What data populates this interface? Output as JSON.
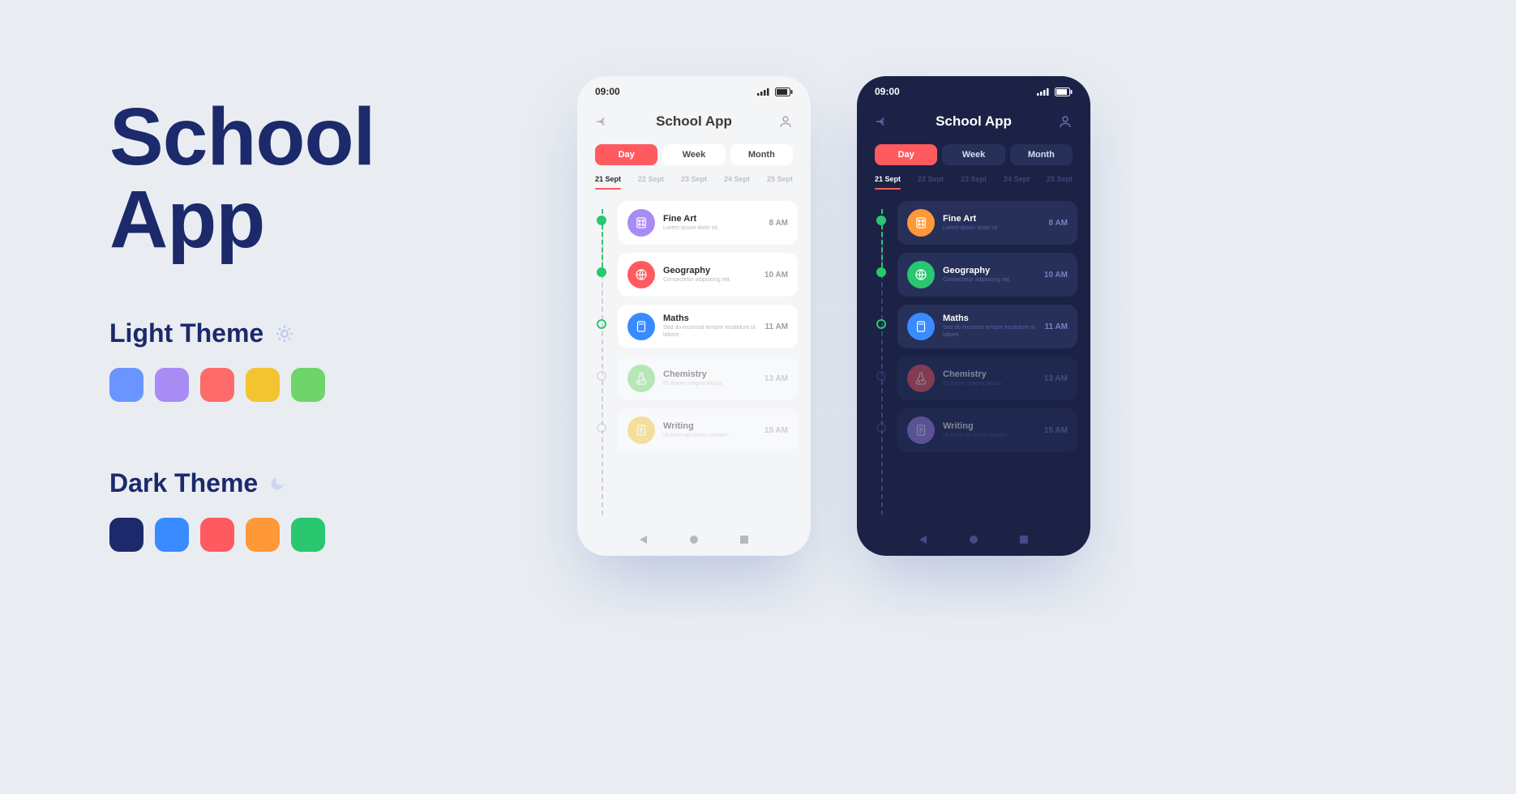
{
  "hero": {
    "line1": "School",
    "line2": "App"
  },
  "themes": {
    "light": {
      "label": "Light Theme",
      "icon": "sun",
      "swatches": [
        "#6a94ff",
        "#a88cf4",
        "#ff6a6a",
        "#f4c330",
        "#6fd46a"
      ]
    },
    "dark": {
      "label": "Dark Theme",
      "icon": "moon",
      "swatches": [
        "#1c2a6b",
        "#398bff",
        "#ff5a5f",
        "#ff9838",
        "#29c76f"
      ]
    }
  },
  "app": {
    "status_time": "09:00",
    "title": "School App",
    "tabs": [
      {
        "label": "Day",
        "active": true
      },
      {
        "label": "Week",
        "active": false
      },
      {
        "label": "Month",
        "active": false
      }
    ],
    "dates": [
      {
        "label": "21 Sept",
        "active": true
      },
      {
        "label": "22 Sept",
        "active": false
      },
      {
        "label": "23 Sept",
        "active": false
      },
      {
        "label": "24 Sept",
        "active": false
      },
      {
        "label": "25 Sept",
        "active": false
      }
    ],
    "lessons": [
      {
        "title": "Fine Art",
        "time": "8 AM",
        "sub": "Lorem ipsum dolor sit.",
        "status": "done",
        "icon": "palette",
        "color_light": "#a88cf4",
        "color_dark": "#ff9838"
      },
      {
        "title": "Geography",
        "time": "10 AM",
        "sub": "Consectetur adipiscing elit.",
        "status": "done",
        "icon": "globe",
        "color_light": "#ff5a5f",
        "color_dark": "#29c76f"
      },
      {
        "title": "Maths",
        "time": "11 AM",
        "sub": "Sed do eiusmod tempor incididunt ut labore.",
        "status": "now",
        "icon": "calculator",
        "color_light": "#398bff",
        "color_dark": "#398bff"
      },
      {
        "title": "Chemistry",
        "time": "13 AM",
        "sub": "Et dolore magna aliqua.",
        "status": "future",
        "icon": "flask",
        "color_light": "#6fd46a",
        "color_dark": "#ff5a5f"
      },
      {
        "title": "Writing",
        "time": "15 AM",
        "sub": "Ut enim ad minim veniam.",
        "status": "future",
        "icon": "notes",
        "color_light": "#f4c330",
        "color_dark": "#a88cf4"
      }
    ]
  }
}
